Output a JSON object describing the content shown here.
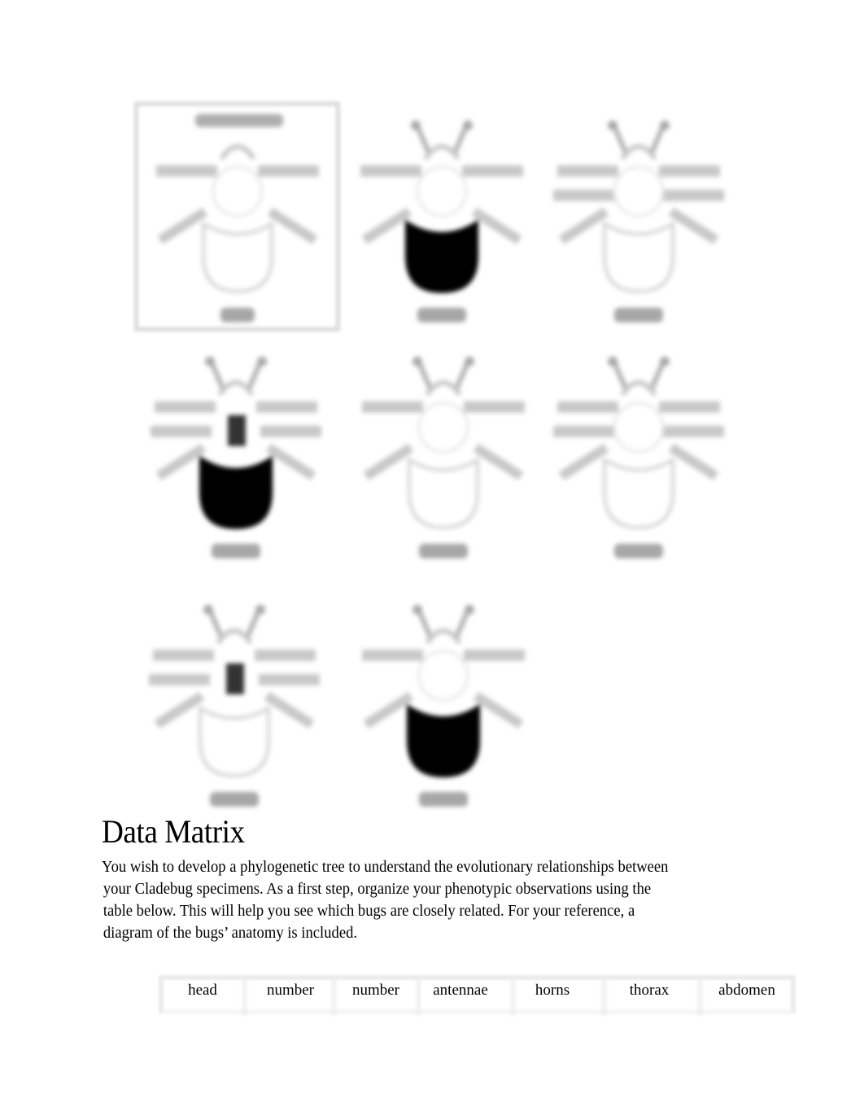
{
  "document": {
    "bug_illustrations": {
      "anatomy_diagram": {
        "title_label": "",
        "specimen_label": "",
        "note": "blurred reference diagram"
      },
      "specimens": [
        {
          "label": "",
          "thorax": "white",
          "abdomen": "black",
          "row": 1
        },
        {
          "label": "",
          "thorax": "white",
          "abdomen": "white",
          "row": 1
        },
        {
          "label": "",
          "thorax": "black-pinched",
          "abdomen": "black",
          "row": 2
        },
        {
          "label": "",
          "thorax": "white",
          "abdomen": "white",
          "row": 2
        },
        {
          "label": "",
          "thorax": "white",
          "abdomen": "white",
          "row": 2
        },
        {
          "label": "",
          "thorax": "black-pinched",
          "abdomen": "white",
          "row": 3
        },
        {
          "label": "",
          "thorax": "white",
          "abdomen": "black",
          "row": 3
        }
      ]
    },
    "section_title": "Data Matrix",
    "paragraph_lines": [
      "You wish to develop a phylogenetic tree to understand the evolutionary relationships between",
      "your Cladebug specimens.  As a first step, organize your phenotypic observations using the",
      "table below.   This will help you see which bugs are closely related. For your reference, a",
      "diagram of the bugs’ anatomy is included."
    ],
    "matrix_table": {
      "headers": [
        "head",
        "number",
        "number",
        "antennae",
        "horns",
        "thorax",
        "abdomen"
      ]
    }
  }
}
